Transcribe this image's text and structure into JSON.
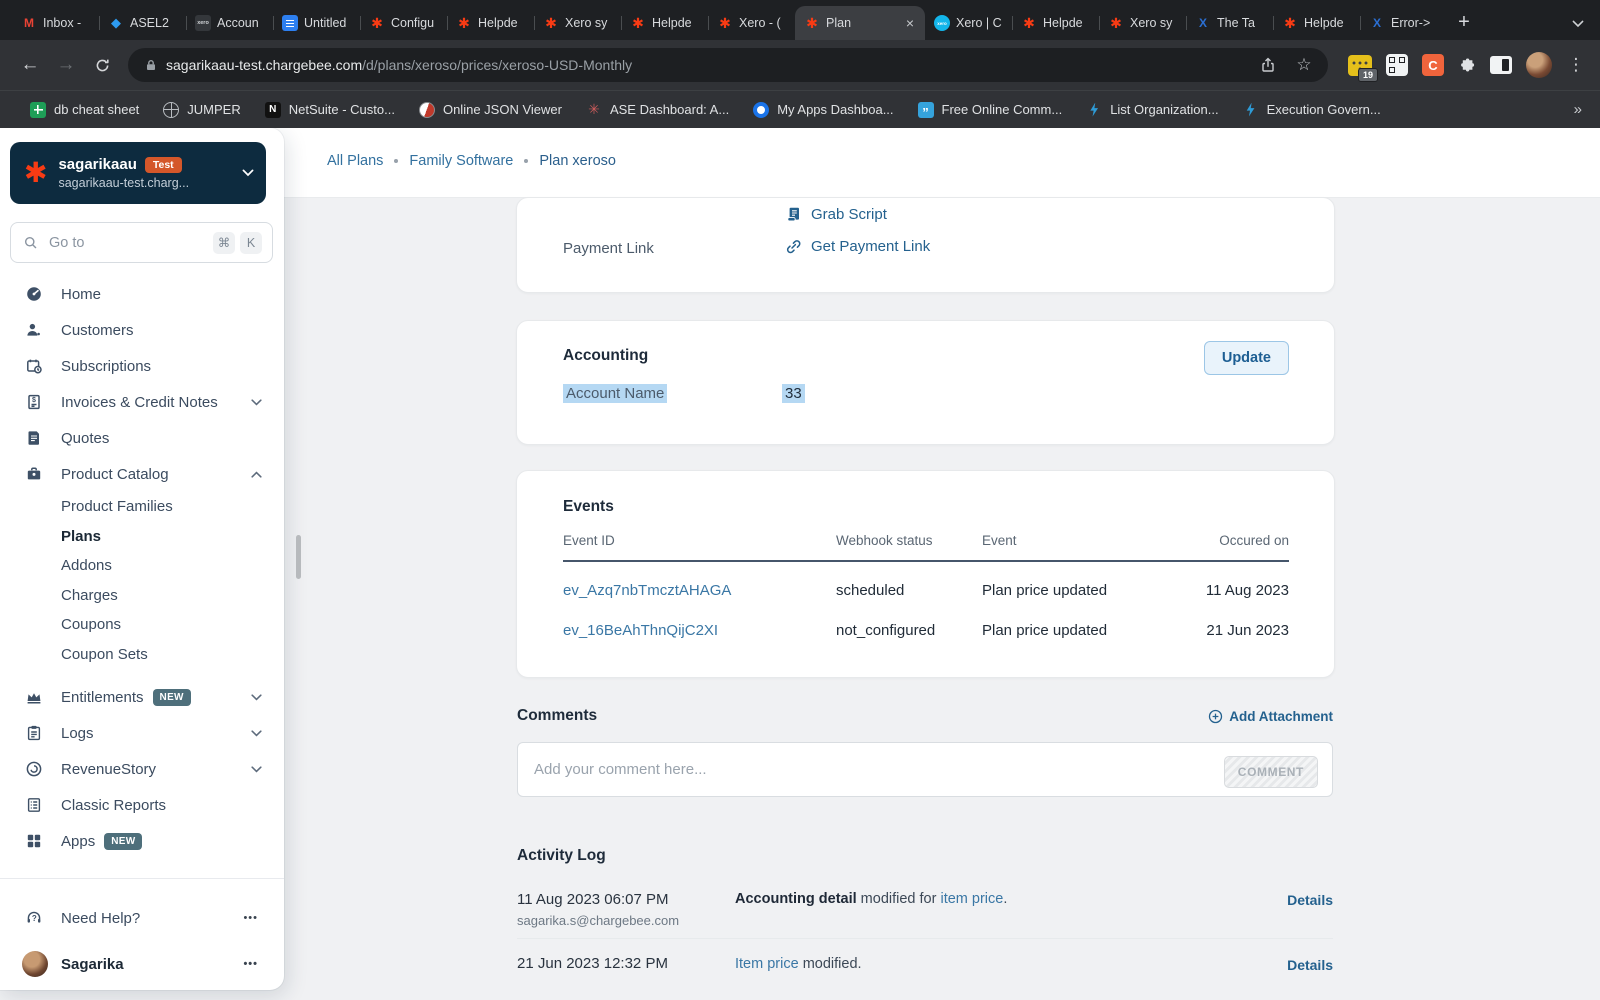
{
  "browser": {
    "tabs": [
      {
        "title": "Inbox -",
        "icon": "gmail"
      },
      {
        "title": "ASEL2",
        "icon": "diamond"
      },
      {
        "title": "Accoun",
        "icon": "xero-dark"
      },
      {
        "title": "Untitled",
        "icon": "docs"
      },
      {
        "title": "Configu",
        "icon": "chargebee"
      },
      {
        "title": "Helpde",
        "icon": "chargebee"
      },
      {
        "title": "Xero sy",
        "icon": "chargebee"
      },
      {
        "title": "Helpde",
        "icon": "chargebee"
      },
      {
        "title": "Xero - (",
        "icon": "chargebee"
      },
      {
        "title": "Plan",
        "icon": "chargebee",
        "active": true
      },
      {
        "title": "Xero | C",
        "icon": "xero"
      },
      {
        "title": "Helpde",
        "icon": "chargebee"
      },
      {
        "title": "Xero sy",
        "icon": "chargebee"
      },
      {
        "title": "The Ta",
        "icon": "tableau"
      },
      {
        "title": "Helpde",
        "icon": "chargebee"
      },
      {
        "title": "Error->",
        "icon": "tableau"
      }
    ],
    "url_domain": "sagarikaau-test.chargebee.com",
    "url_path": "/d/plans/xeroso/prices/xeroso-USD-Monthly",
    "extension_badge": "19",
    "bookmarks": [
      {
        "label": "db cheat sheet",
        "icon": "sheet"
      },
      {
        "label": "JUMPER",
        "icon": "globe"
      },
      {
        "label": "NetSuite - Custo...",
        "icon": "n"
      },
      {
        "label": "Online JSON Viewer",
        "icon": "json"
      },
      {
        "label": "ASE Dashboard: A...",
        "icon": "sparkle"
      },
      {
        "label": "My Apps Dashboa...",
        "icon": "ring"
      },
      {
        "label": "Free Online Comm...",
        "icon": "quote"
      },
      {
        "label": "List Organization...",
        "icon": "bolt"
      },
      {
        "label": "Execution Govern...",
        "icon": "bolt"
      }
    ]
  },
  "sidebar": {
    "org_name": "sagarikaau",
    "org_badge": "Test",
    "org_domain": "sagarikaau-test.charg...",
    "search_placeholder": "Go to",
    "shortcut_cmd": "⌘",
    "shortcut_k": "K",
    "nav": [
      {
        "label": "Home",
        "icon": "gauge"
      },
      {
        "label": "Customers",
        "icon": "users"
      },
      {
        "label": "Subscriptions",
        "icon": "calendar"
      },
      {
        "label": "Invoices & Credit Notes",
        "icon": "invoice",
        "chevron": "down"
      },
      {
        "label": "Quotes",
        "icon": "quote"
      },
      {
        "label": "Product Catalog",
        "icon": "catalog",
        "chevron": "up"
      },
      {
        "label": "Product Families",
        "sub": true
      },
      {
        "label": "Plans",
        "sub": true,
        "active": true
      },
      {
        "label": "Addons",
        "sub": true
      },
      {
        "label": "Charges",
        "sub": true
      },
      {
        "label": "Coupons",
        "sub": true
      },
      {
        "label": "Coupon Sets",
        "sub": true
      },
      {
        "label": "Entitlements",
        "icon": "crown",
        "badge": "NEW",
        "chevron": "down",
        "gap": true
      },
      {
        "label": "Logs",
        "icon": "clipboard",
        "chevron": "down"
      },
      {
        "label": "RevenueStory",
        "icon": "revenue",
        "chevron": "down"
      },
      {
        "label": "Classic Reports",
        "icon": "report"
      },
      {
        "label": "Apps",
        "icon": "grid",
        "badge": "NEW"
      }
    ],
    "help_label": "Need Help?",
    "user_name": "Sagarika"
  },
  "main": {
    "breadcrumb": [
      "All Plans",
      "Family Software",
      "Plan xeroso"
    ],
    "payment": {
      "grab_script": "Grab Script",
      "label": "Payment Link",
      "link": "Get Payment Link"
    },
    "accounting": {
      "title": "Accounting",
      "update": "Update",
      "field_label": "Account Name",
      "field_value": "33"
    },
    "events": {
      "title": "Events",
      "columns": [
        "Event ID",
        "Webhook status",
        "Event",
        "Occured on"
      ],
      "rows": [
        {
          "id": "ev_Azq7nbTmcztAHAGA",
          "webhook": "scheduled",
          "event": "Plan price updated",
          "date": "11 Aug 2023"
        },
        {
          "id": "ev_16BeAhThnQijC2XI",
          "webhook": "not_configured",
          "event": "Plan price updated",
          "date": "21 Jun 2023"
        }
      ]
    },
    "comments": {
      "title": "Comments",
      "add_attachment": "Add Attachment",
      "placeholder": "Add your comment here...",
      "button": "COMMENT"
    },
    "activity": {
      "title": "Activity Log",
      "entries": [
        {
          "time": "11 Aug 2023 06:07 PM",
          "user": "sagarika.s@chargebee.com",
          "bold": "Accounting detail",
          "mid": " modified for ",
          "link": "item price",
          "end": ".",
          "details": "Details"
        },
        {
          "time": "21 Jun 2023 12:32 PM",
          "user": "",
          "bold": "",
          "mid": "",
          "link": "Item price",
          "end": " modified.",
          "details": "Details"
        }
      ]
    }
  },
  "colors": {
    "accent_link": "#24618e",
    "table_link": "#3a77a5",
    "selection": "#b5d8f3",
    "chargebee_red": "#f83b14",
    "test_badge": "#d4572a",
    "new_badge": "#4e6f7b"
  }
}
